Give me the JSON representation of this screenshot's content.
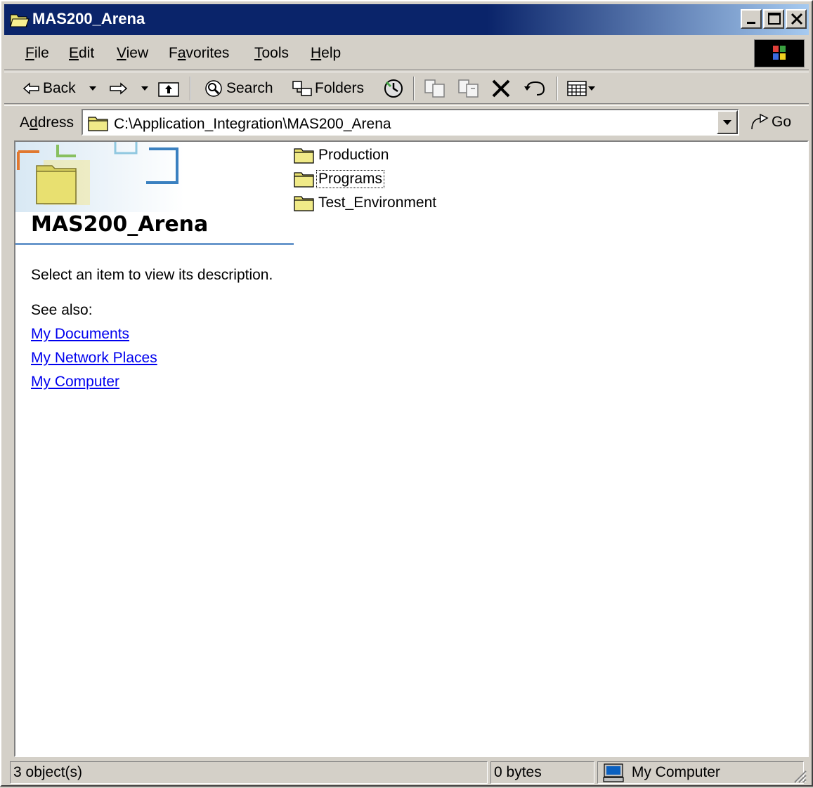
{
  "window": {
    "title": "MAS200_Arena",
    "buttons": {
      "minimize": "minimize",
      "maximize": "maximize",
      "close": "close"
    }
  },
  "menu": {
    "items": [
      {
        "key": "F",
        "rest": "ile"
      },
      {
        "key": "E",
        "rest": "dit"
      },
      {
        "key": "V",
        "rest": "iew"
      },
      {
        "pre": "F",
        "key": "a",
        "rest": "vorites"
      },
      {
        "key": "T",
        "rest": "ools"
      },
      {
        "key": "H",
        "rest": "elp"
      }
    ]
  },
  "toolbar": {
    "back_label": "Back",
    "search_label": "Search",
    "folders_label": "Folders"
  },
  "address": {
    "label_pre": "A",
    "label_key": "d",
    "label_rest": "dress",
    "value": "C:\\Application_Integration\\MAS200_Arena",
    "go_label": "Go"
  },
  "left_pane": {
    "title": "MAS200_Arena",
    "description": "Select an item to view its description.",
    "see_also": "See also:",
    "links": [
      "My Documents",
      "My Network Places",
      "My Computer"
    ]
  },
  "files": [
    {
      "name": "Production"
    },
    {
      "name": "Programs"
    },
    {
      "name": "Test_Environment"
    }
  ],
  "status": {
    "objects": "3 object(s)",
    "size": "0 bytes",
    "zone": "My Computer"
  },
  "colors": {
    "title_bar": "#0a246a",
    "face": "#d4d0c8",
    "link": "#0000ee",
    "folder": "#e8e070"
  }
}
